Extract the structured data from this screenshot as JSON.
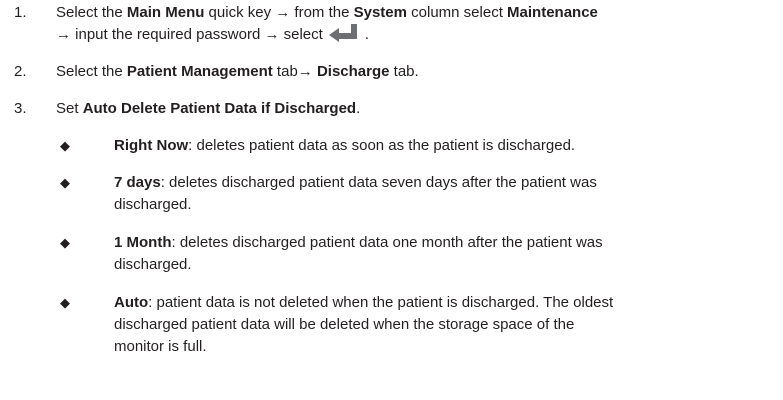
{
  "steps": [
    {
      "num": "1.",
      "parts": {
        "a": "Select the ",
        "b": "Main Menu",
        "c": " quick key → from the ",
        "d": "System",
        "e": " column select ",
        "f": "Maintenance",
        "g": "→ input the required password → select",
        "h": "."
      },
      "icon": "enter-key-icon"
    },
    {
      "num": "2.",
      "parts": {
        "a": "Select the ",
        "b": "Patient Management",
        "c": " tab→ ",
        "d": "Discharge",
        "e": " tab."
      }
    },
    {
      "num": "3.",
      "parts": {
        "a": "Set ",
        "b": "Auto Delete Patient Data if Discharged",
        "c": "."
      }
    }
  ],
  "bullets": [
    {
      "mark": "◆",
      "term": "Right Now",
      "line1": ": deletes patient data as soon as the patient is discharged."
    },
    {
      "mark": "◆",
      "term": "7 days",
      "line1": ": deletes discharged patient data seven days after the patient was",
      "line2": "discharged."
    },
    {
      "mark": "◆",
      "term": "1 Month",
      "line1": ": deletes discharged patient data one month after the patient was",
      "line2": "discharged."
    },
    {
      "mark": "◆",
      "term": "Auto",
      "line1": ": patient data is not deleted when the patient is discharged. The oldest",
      "line2": "discharged patient data will be deleted when the storage space of the",
      "line3": "monitor is full."
    }
  ],
  "colors": {
    "text": "#231f20",
    "icon": "#6d6e71"
  }
}
